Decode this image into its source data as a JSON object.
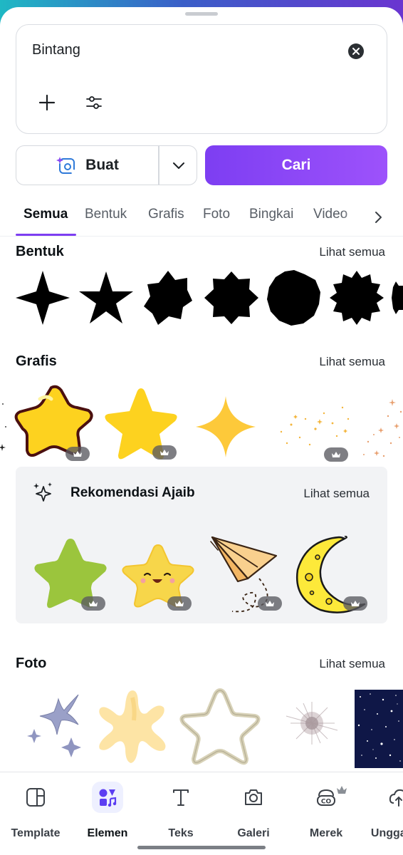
{
  "search": {
    "query": "Bintang"
  },
  "actions": {
    "create_label": "Buat",
    "search_label": "Cari"
  },
  "tabs": [
    {
      "label": "Semua",
      "active": true
    },
    {
      "label": "Bentuk"
    },
    {
      "label": "Grafis"
    },
    {
      "label": "Foto"
    },
    {
      "label": "Bingkai"
    },
    {
      "label": "Video"
    }
  ],
  "sections": {
    "bentuk": {
      "title": "Bentuk",
      "see_all": "Lihat semua"
    },
    "grafis": {
      "title": "Grafis",
      "see_all": "Lihat semua"
    },
    "magic": {
      "title": "Rekomendasi Ajaib",
      "see_all": "Lihat semua"
    },
    "foto": {
      "title": "Foto",
      "see_all": "Lihat semua"
    }
  },
  "nav": [
    {
      "label": "Template",
      "icon": "template-icon"
    },
    {
      "label": "Elemen",
      "icon": "elements-icon",
      "active": true
    },
    {
      "label": "Teks",
      "icon": "text-icon"
    },
    {
      "label": "Galeri",
      "icon": "camera-icon"
    },
    {
      "label": "Merek",
      "icon": "brand-icon"
    },
    {
      "label": "Unggahan",
      "icon": "upload-icon"
    }
  ],
  "colors": {
    "accent": "#7d3ef2",
    "star_yellow": "#fdd21f",
    "lime": "#9bc53d"
  }
}
